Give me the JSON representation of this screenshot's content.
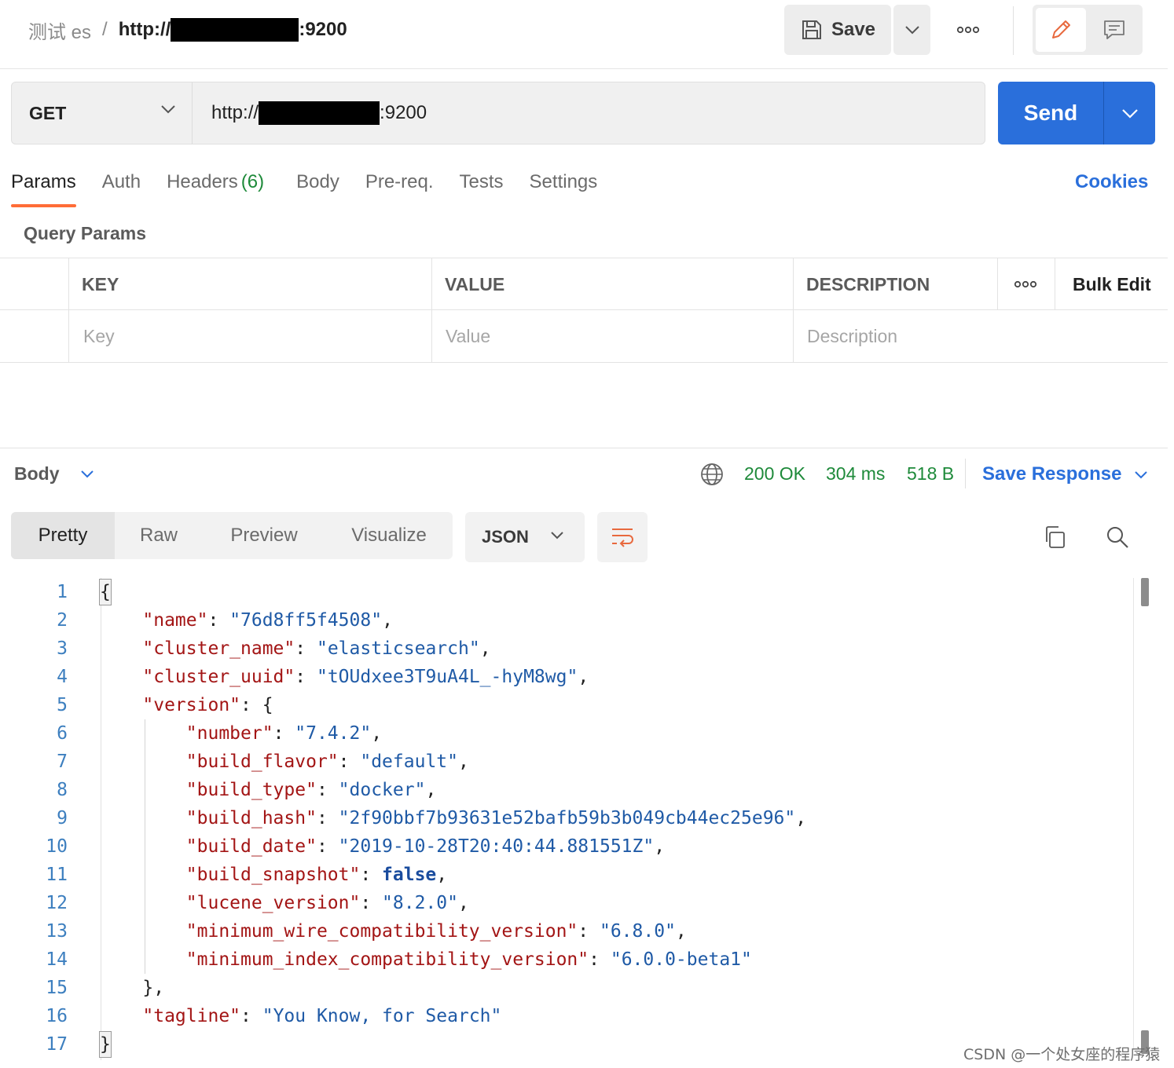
{
  "breadcrumb": {
    "collection": "测试 es",
    "separator": "/",
    "request_name_prefix": "http://",
    "request_name_suffix": ":9200"
  },
  "toolbar": {
    "save_label": "Save"
  },
  "request": {
    "method": "GET",
    "url_prefix": "http://",
    "url_suffix": ":9200",
    "send_label": "Send"
  },
  "tabs": [
    {
      "label": "Params",
      "active": true
    },
    {
      "label": "Auth"
    },
    {
      "label": "Headers",
      "count": "(6)"
    },
    {
      "label": "Body"
    },
    {
      "label": "Pre-req."
    },
    {
      "label": "Tests"
    },
    {
      "label": "Settings"
    }
  ],
  "cookies_label": "Cookies",
  "query_params": {
    "title": "Query Params",
    "headers": {
      "key": "KEY",
      "value": "VALUE",
      "description": "DESCRIPTION",
      "bulk_edit": "Bulk Edit"
    },
    "placeholders": {
      "key": "Key",
      "value": "Value",
      "description": "Description"
    }
  },
  "response": {
    "section_label": "Body",
    "status": "200 OK",
    "time": "304 ms",
    "size": "518 B",
    "save_response_label": "Save Response",
    "views": [
      "Pretty",
      "Raw",
      "Preview",
      "Visualize"
    ],
    "active_view": "Pretty",
    "format": "JSON"
  },
  "code_lines": [
    {
      "n": "1",
      "tokens": [
        [
          "brace-hl",
          "{"
        ]
      ]
    },
    {
      "n": "2",
      "tokens": [
        [
          "p",
          "    "
        ],
        [
          "k",
          "\"name\""
        ],
        [
          "p",
          ": "
        ],
        [
          "s",
          "\"76d8ff5f4508\""
        ],
        [
          "p",
          ","
        ]
      ]
    },
    {
      "n": "3",
      "tokens": [
        [
          "p",
          "    "
        ],
        [
          "k",
          "\"cluster_name\""
        ],
        [
          "p",
          ": "
        ],
        [
          "s",
          "\"elasticsearch\""
        ],
        [
          "p",
          ","
        ]
      ]
    },
    {
      "n": "4",
      "tokens": [
        [
          "p",
          "    "
        ],
        [
          "k",
          "\"cluster_uuid\""
        ],
        [
          "p",
          ": "
        ],
        [
          "s",
          "\"tOUdxee3T9uA4L_-hyM8wg\""
        ],
        [
          "p",
          ","
        ]
      ]
    },
    {
      "n": "5",
      "tokens": [
        [
          "p",
          "    "
        ],
        [
          "k",
          "\"version\""
        ],
        [
          "p",
          ": {"
        ]
      ]
    },
    {
      "n": "6",
      "tokens": [
        [
          "p",
          "        "
        ],
        [
          "k",
          "\"number\""
        ],
        [
          "p",
          ": "
        ],
        [
          "s",
          "\"7.4.2\""
        ],
        [
          "p",
          ","
        ]
      ]
    },
    {
      "n": "7",
      "tokens": [
        [
          "p",
          "        "
        ],
        [
          "k",
          "\"build_flavor\""
        ],
        [
          "p",
          ": "
        ],
        [
          "s",
          "\"default\""
        ],
        [
          "p",
          ","
        ]
      ]
    },
    {
      "n": "8",
      "tokens": [
        [
          "p",
          "        "
        ],
        [
          "k",
          "\"build_type\""
        ],
        [
          "p",
          ": "
        ],
        [
          "s",
          "\"docker\""
        ],
        [
          "p",
          ","
        ]
      ]
    },
    {
      "n": "9",
      "tokens": [
        [
          "p",
          "        "
        ],
        [
          "k",
          "\"build_hash\""
        ],
        [
          "p",
          ": "
        ],
        [
          "s",
          "\"2f90bbf7b93631e52bafb59b3b049cb44ec25e96\""
        ],
        [
          "p",
          ","
        ]
      ]
    },
    {
      "n": "10",
      "tokens": [
        [
          "p",
          "        "
        ],
        [
          "k",
          "\"build_date\""
        ],
        [
          "p",
          ": "
        ],
        [
          "s",
          "\"2019-10-28T20:40:44.881551Z\""
        ],
        [
          "p",
          ","
        ]
      ]
    },
    {
      "n": "11",
      "tokens": [
        [
          "p",
          "        "
        ],
        [
          "k",
          "\"build_snapshot\""
        ],
        [
          "p",
          ": "
        ],
        [
          "b",
          "false"
        ],
        [
          "p",
          ","
        ]
      ]
    },
    {
      "n": "12",
      "tokens": [
        [
          "p",
          "        "
        ],
        [
          "k",
          "\"lucene_version\""
        ],
        [
          "p",
          ": "
        ],
        [
          "s",
          "\"8.2.0\""
        ],
        [
          "p",
          ","
        ]
      ]
    },
    {
      "n": "13",
      "tokens": [
        [
          "p",
          "        "
        ],
        [
          "k",
          "\"minimum_wire_compatibility_version\""
        ],
        [
          "p",
          ": "
        ],
        [
          "s",
          "\"6.8.0\""
        ],
        [
          "p",
          ","
        ]
      ]
    },
    {
      "n": "14",
      "tokens": [
        [
          "p",
          "        "
        ],
        [
          "k",
          "\"minimum_index_compatibility_version\""
        ],
        [
          "p",
          ": "
        ],
        [
          "s",
          "\"6.0.0-beta1\""
        ]
      ]
    },
    {
      "n": "15",
      "tokens": [
        [
          "p",
          "    },"
        ]
      ]
    },
    {
      "n": "16",
      "tokens": [
        [
          "p",
          "    "
        ],
        [
          "k",
          "\"tagline\""
        ],
        [
          "p",
          ": "
        ],
        [
          "s",
          "\"You Know, for Search\""
        ]
      ]
    },
    {
      "n": "17",
      "tokens": [
        [
          "brace-hl",
          "}"
        ]
      ]
    }
  ],
  "watermark": "CSDN @一个处女座的程序猿"
}
